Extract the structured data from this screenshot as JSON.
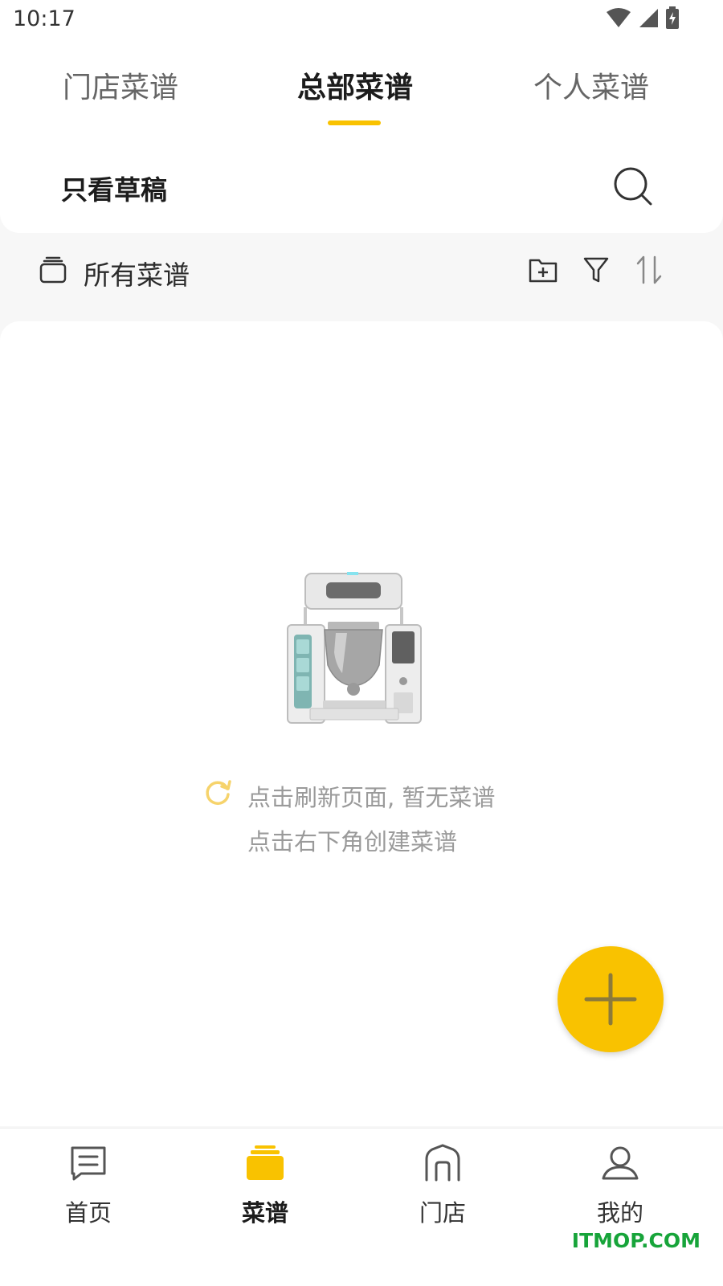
{
  "status_bar": {
    "time": "10:17"
  },
  "tabs": [
    {
      "label": "门店菜谱",
      "active": false
    },
    {
      "label": "总部菜谱",
      "active": true
    },
    {
      "label": "个人菜谱",
      "active": false
    }
  ],
  "filter_row": {
    "draft_label": "只看草稿",
    "search_icon": "search-icon"
  },
  "toolbar": {
    "all_label": "所有菜谱",
    "icons": [
      "folder-add-icon",
      "filter-icon",
      "sort-icon"
    ]
  },
  "empty_state": {
    "line1": "点击刷新页面, 暂无菜谱",
    "line2": "点击右下角创建菜谱",
    "refresh_icon": "refresh-icon"
  },
  "fab": {
    "icon": "plus-icon"
  },
  "bottom_nav": [
    {
      "label": "首页",
      "icon": "home-message-icon",
      "active": false
    },
    {
      "label": "菜谱",
      "icon": "recipes-stack-icon",
      "active": true
    },
    {
      "label": "门店",
      "icon": "store-icon",
      "active": false
    },
    {
      "label": "我的",
      "icon": "profile-icon",
      "active": false
    }
  ],
  "watermark": "ITMOP.COM",
  "colors": {
    "accent": "#f9c200",
    "background": "#f7f7f7",
    "watermark": "#17a43a"
  }
}
